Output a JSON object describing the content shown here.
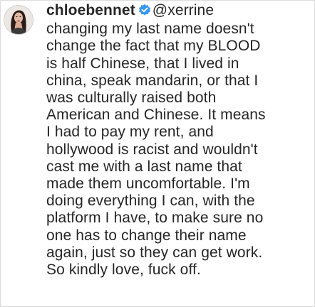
{
  "comment": {
    "username": "chloebennet",
    "verified_icon": "verified-badge-icon",
    "verified_color": "#3897f0",
    "mention": "@xerrine",
    "lines": [
      "changing my last name doesn't",
      "change the fact that my BLOOD",
      "is half Chinese, that I lived in",
      "china, speak mandarin, or that I",
      "was culturally raised both",
      "American and Chinese. It means",
      "I had to pay my rent, and",
      "hollywood is racist and wouldn't",
      "cast me with a last name that",
      "made them uncomfortable. I'm",
      "doing everything I can, with the",
      "platform I have, to make sure no",
      "one has to change their name",
      "again, just so they can get work.",
      "So kindly love, fuck off."
    ]
  }
}
